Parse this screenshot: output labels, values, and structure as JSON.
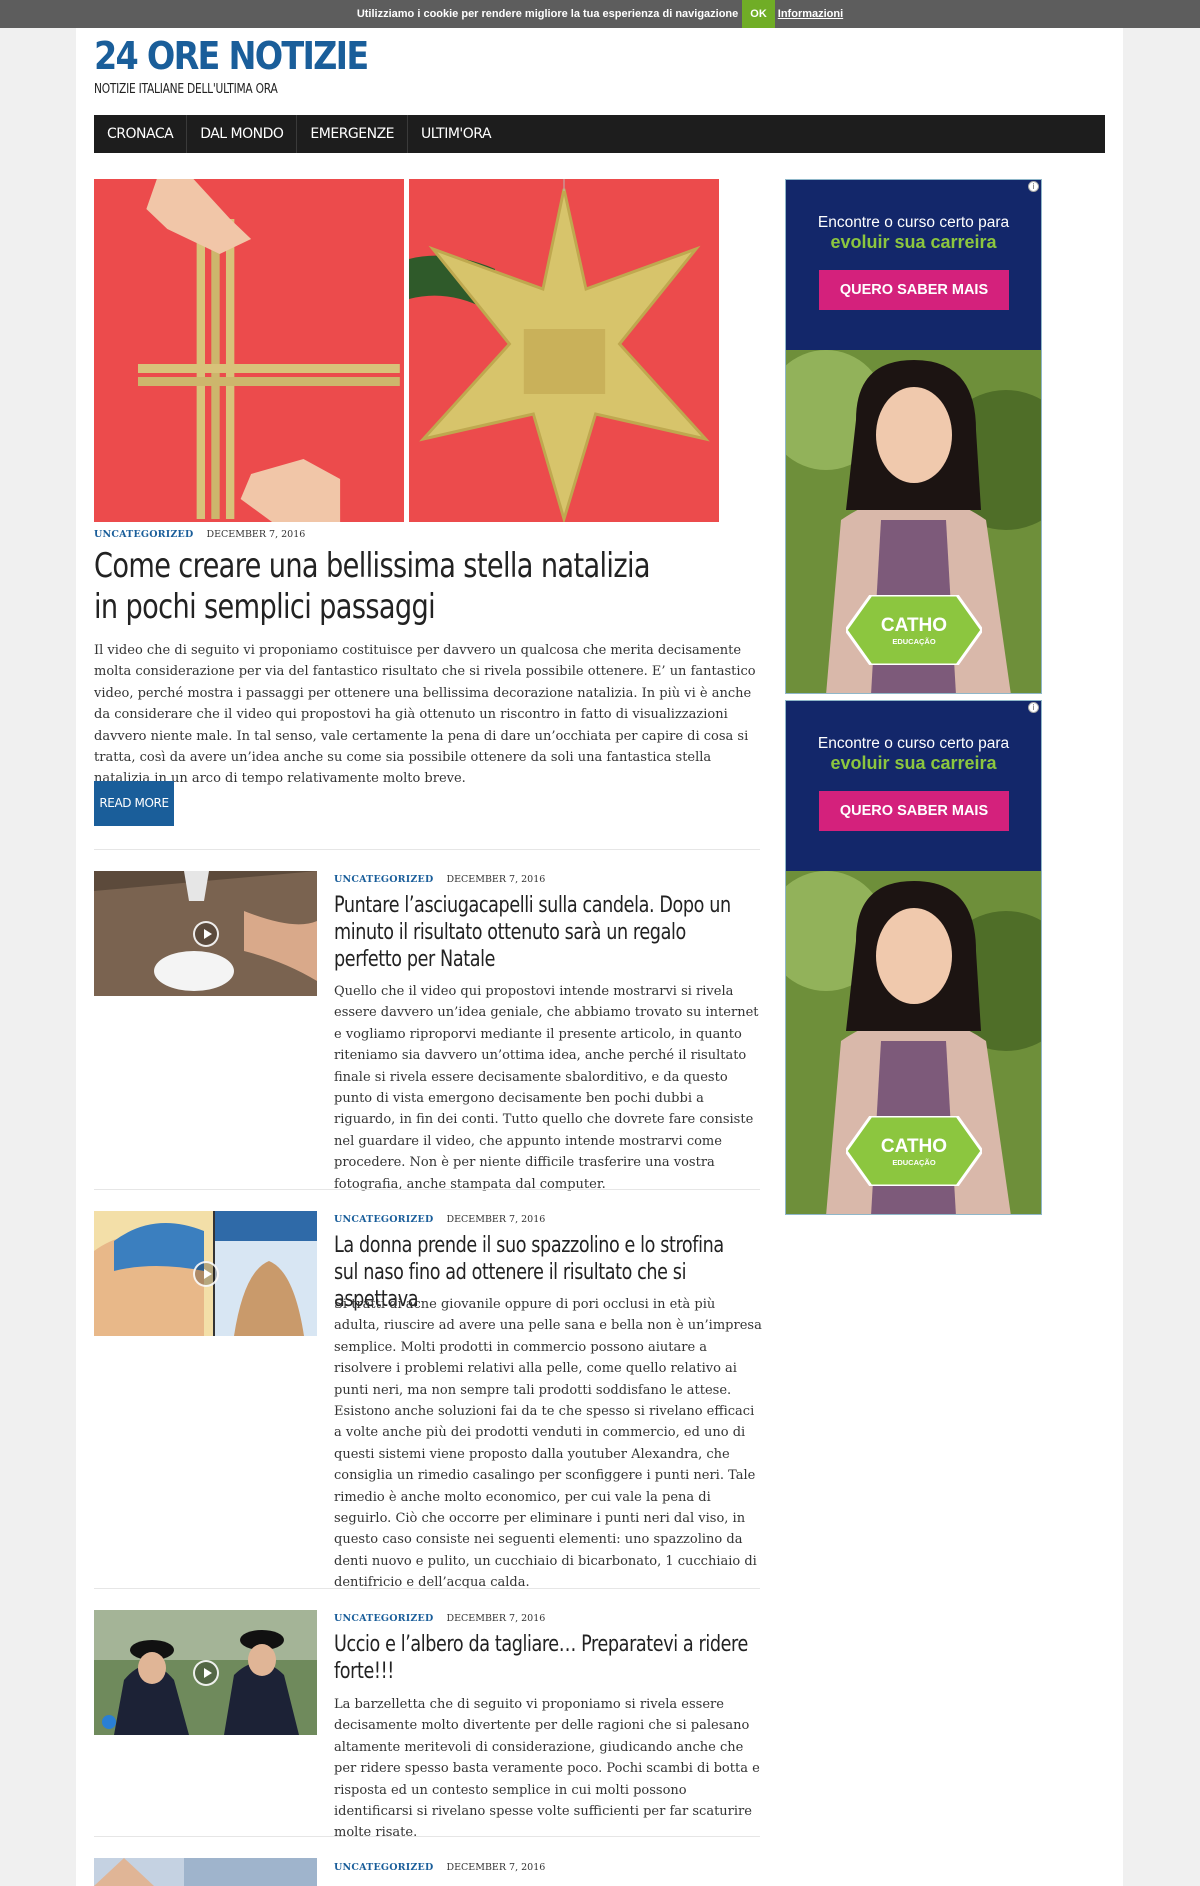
{
  "cookie_bar": {
    "message": "Utilizziamo i cookie per rendere migliore la tua esperienza di navigazione",
    "ok_label": "OK",
    "info_label": "Informazioni"
  },
  "site": {
    "title": "24 ORE NOTIZIE",
    "tagline": "NOTIZIE ITALIANE DELL'ULTIMA ORA"
  },
  "nav": {
    "items": [
      {
        "label": "CRONACA"
      },
      {
        "label": "DAL MONDO"
      },
      {
        "label": "EMERGENZE"
      },
      {
        "label": "ULTIM'ORA"
      }
    ]
  },
  "hero": {
    "category": "UNCATEGORIZED",
    "date": "DECEMBER 7, 2016",
    "title": "Come creare una bellissima stella natalizia in pochi semplici passaggi",
    "excerpt": "Il video che di seguito vi proponiamo costituisce per davvero un qualcosa che merita decisamente molta considerazione per via del fantastico risultato che si rivela possibile ottenere. E’ un fantastico video, perché mostra i passaggi per ottenere una bellissima decorazione natalizia. In più vi è anche da considerare che il video qui propostovi ha già ottenuto un riscontro in fatto di visualizzazioni davvero niente male. In tal senso, vale certamente la pena di dare un’occhiata per capire di cosa si tratta, così da avere un’idea anche su come sia possibile ottenere da soli una fantastica stella natalizia in un arco di tempo relativamente molto breve.",
    "read_more": "READ MORE"
  },
  "posts": [
    {
      "category": "UNCATEGORIZED",
      "date": "DECEMBER 7, 2016",
      "title": "Puntare l’asciugacapelli sulla candela. Dopo un minuto il risultato ottenuto sarà un regalo perfetto per Natale",
      "excerpt": "Quello che il video qui propostovi intende mostrarvi si rivela essere davvero un’idea geniale, che abbiamo trovato su internet e vogliamo riproporvi mediante il presente articolo, in quanto riteniamo sia davvero un’ottima idea, anche perché il risultato finale si rivela essere decisamente sbalorditivo, e da questo punto di vista emergono decisamente ben pochi dubbi a riguardo, in fin dei conti. Tutto quello che dovrete fare consiste nel guardare il video, che appunto intende mostrarvi come procedere. Non è per niente difficile trasferire una vostra fotografia, anche stampata dal computer."
    },
    {
      "category": "UNCATEGORIZED",
      "date": "DECEMBER 7, 2016",
      "title": "La donna prende il suo spazzolino e lo strofina sul naso fino ad ottenere il risultato che si aspettava",
      "excerpt": "Si tratti di acne giovanile oppure di pori occlusi in età più adulta, riuscire ad avere una pelle sana e bella non è un’impresa semplice. Molti prodotti in commercio possono aiutare a risolvere i problemi relativi alla pelle, come quello relativo ai punti neri, ma non sempre tali prodotti soddisfano le attese. Esistono anche soluzioni fai da te che spesso si rivelano efficaci a volte anche più dei prodotti venduti in commercio, ed uno di questi sistemi viene proposto dalla youtuber Alexandra, che consiglia un rimedio casalingo per sconfiggere i punti neri. Tale rimedio è anche molto economico, per cui vale la pena di seguirlo. Ciò che occorre per eliminare i punti neri dal viso, in questo caso consiste nei seguenti elementi: uno spazzolino da denti nuovo e pulito, un cucchiaio di bicarbonato, 1 cucchiaio di dentifricio e dell’acqua calda."
    },
    {
      "category": "UNCATEGORIZED",
      "date": "DECEMBER 7, 2016",
      "title": "Uccio e l’albero da tagliare… Preparatevi a ridere forte!!!",
      "excerpt": "La barzelletta che di seguito vi proponiamo si rivela essere decisamente molto divertente per delle ragioni che si palesano altamente meritevoli di considerazione, giudicando anche che per ridere spesso basta veramente poco. Pochi scambi di botta e risposta ed un contesto semplice in cui molti possono identificarsi si rivelano spesse volte sufficienti per far scaturire molte risate."
    },
    {
      "category": "UNCATEGORIZED",
      "date": "DECEMBER 7, 2016"
    }
  ],
  "ads": [
    {
      "line1": "Encontre o curso certo para",
      "line2": "evoluir sua carreira",
      "cta": "QUERO SABER MAIS",
      "brand": "CATHO",
      "brand_sub": "EDUCAÇÃO",
      "info_icon": "i"
    },
    {
      "line1": "Encontre o curso certo para",
      "line2": "evoluir sua carreira",
      "cta": "QUERO SABER MAIS",
      "brand": "CATHO",
      "brand_sub": "EDUCAÇÃO",
      "info_icon": "i"
    }
  ],
  "colors": {
    "brand_blue": "#1a5e9a",
    "nav_bg": "#1d1d1d",
    "cookie_ok": "#70ad26",
    "ad_pink": "#d4217c",
    "ad_green": "#8cc63f"
  }
}
